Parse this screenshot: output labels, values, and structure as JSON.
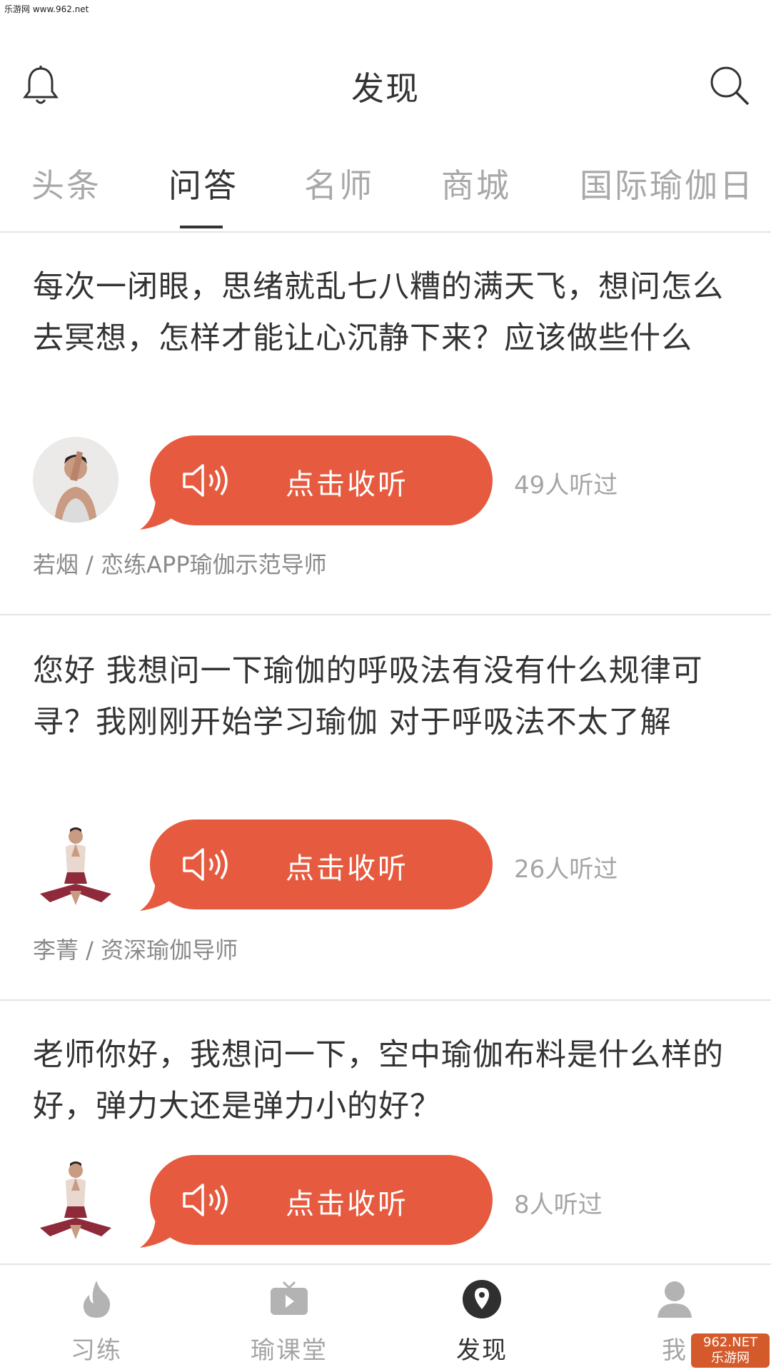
{
  "watermark": {
    "top": "乐游网 www.962.net",
    "logo_line1": "962.NET",
    "logo_line2": "乐游网"
  },
  "header": {
    "title": "发现"
  },
  "tabs": [
    {
      "label": "头条"
    },
    {
      "label": "问答"
    },
    {
      "label": "名师"
    },
    {
      "label": "商城"
    },
    {
      "label": "国际瑜伽日"
    }
  ],
  "active_tab": "问答",
  "listen_label": "点击收听",
  "items": [
    {
      "question": "每次一闭眼，思绪就乱七八糟的满天飞，想问怎么去冥想，怎样才能让心沉静下来？应该做些什么",
      "listened": "49人听过",
      "author": "若烟 / 恋练APP瑜伽示范导师"
    },
    {
      "question": "您好 我想问一下瑜伽的呼吸法有没有什么规律可寻？我刚刚开始学习瑜伽 对于呼吸法不太了解",
      "listened": "26人听过",
      "author": "李菁 / 资深瑜伽导师"
    },
    {
      "question": "老师你好，我想问一下，空中瑜伽布料是什么样的好，弹力大还是弹力小的好？",
      "listened": "8人听过",
      "author": ""
    }
  ],
  "bottom_nav": [
    {
      "label": "习练",
      "icon": "flame-icon"
    },
    {
      "label": "瑜课堂",
      "icon": "tv-icon"
    },
    {
      "label": "发现",
      "icon": "location-pin-icon"
    },
    {
      "label": "我",
      "icon": "user-icon"
    }
  ],
  "colors": {
    "accent": "#e65a3f",
    "text": "#333333",
    "muted": "#a5a5a5"
  }
}
